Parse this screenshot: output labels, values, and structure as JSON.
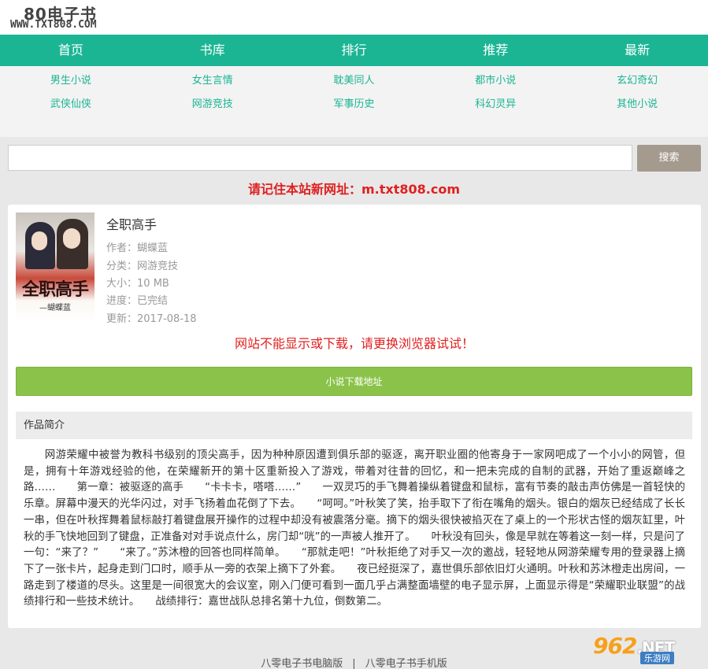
{
  "site": {
    "logo_cn": "80电子书",
    "logo_en": "WWW.TXT808.COM"
  },
  "nav": [
    "首页",
    "书库",
    "排行",
    "推荐",
    "最新"
  ],
  "categories": [
    [
      "男生小说",
      "女生言情",
      "耽美同人",
      "都市小说",
      "玄幻奇幻"
    ],
    [
      "武侠仙侠",
      "网游竞技",
      "军事历史",
      "科幻灵异",
      "其他小说"
    ]
  ],
  "search": {
    "placeholder": "",
    "button": "搜索"
  },
  "notice": "请记住本站新网址：m.txt808.com",
  "book": {
    "title": "全职高手",
    "cover_title": "全职高手",
    "cover_author": "—蝴蝶蓝",
    "author_label": "作者：",
    "author": "蝴蝶蓝",
    "category_label": "分类：",
    "category": "网游竞技",
    "size_label": "大小：",
    "size": "10 MB",
    "status_label": "进度：",
    "status": "已完结",
    "updated_label": "更新：",
    "updated": "2017-08-18"
  },
  "warning": "网站不能显示或下载，请更换浏览器试试！",
  "download_button": "小说下载地址",
  "intro": {
    "heading": "作品简介",
    "text": "网游荣耀中被誉为教科书级别的顶尖高手，因为种种原因遭到俱乐部的驱逐，离开职业圈的他寄身于一家网吧成了一个小小的网管，但是，拥有十年游戏经验的他，在荣耀新开的第十区重新投入了游戏，带着对往昔的回忆，和一把未完成的自制的武器，开始了重返巅峰之路……　　第一章：被驱逐的高手　　“卡卡卡，嗒嗒……”　　一双灵巧的手飞舞着操纵着键盘和鼠标，富有节奏的敲击声仿佛是一首轻快的乐章。屏幕中漫天的光华闪过，对手飞扬着血花倒了下去。　　“呵呵。”叶秋笑了笑，抬手取下了衔在嘴角的烟头。银白的烟灰已经结成了长长一串，但在叶秋挥舞着鼠标敲打着键盘展开操作的过程中却没有被震落分毫。摘下的烟头很快被掐灭在了桌上的一个形状古怪的烟灰缸里，叶秋的手飞快地回到了键盘，正准备对对手说点什么，房门却“咣”的一声被人推开了。　　叶秋没有回头，像是早就在等着这一刻一样，只是问了一句：“来了？”　　“来了。”苏沐橙的回答也同样简单。　　“那就走吧！”叶秋拒绝了对手又一次的邀战，轻轻地从网游荣耀专用的登录器上摘下了一张卡片，起身走到门口时，顺手从一旁的衣架上摘下了外套。　　夜已经挺深了，嘉世俱乐部依旧灯火通明。叶秋和苏沐橙走出房间，一路走到了楼道的尽头。这里是一间很宽大的会议室，刚入门便可看到一面几乎占满整面墙壁的电子显示屏，上面显示得是“荣耀职业联盟”的战绩排行和一些技术统计。　　战绩排行：嘉世战队总排名第十九位，倒数第二。"
  },
  "footer": {
    "pc": "八零电子书电脑版",
    "sep": "|",
    "mobile": "八零电子书手机版"
  },
  "watermark": {
    "logo": "962",
    "net": ".NET",
    "sub": "乐游网"
  }
}
